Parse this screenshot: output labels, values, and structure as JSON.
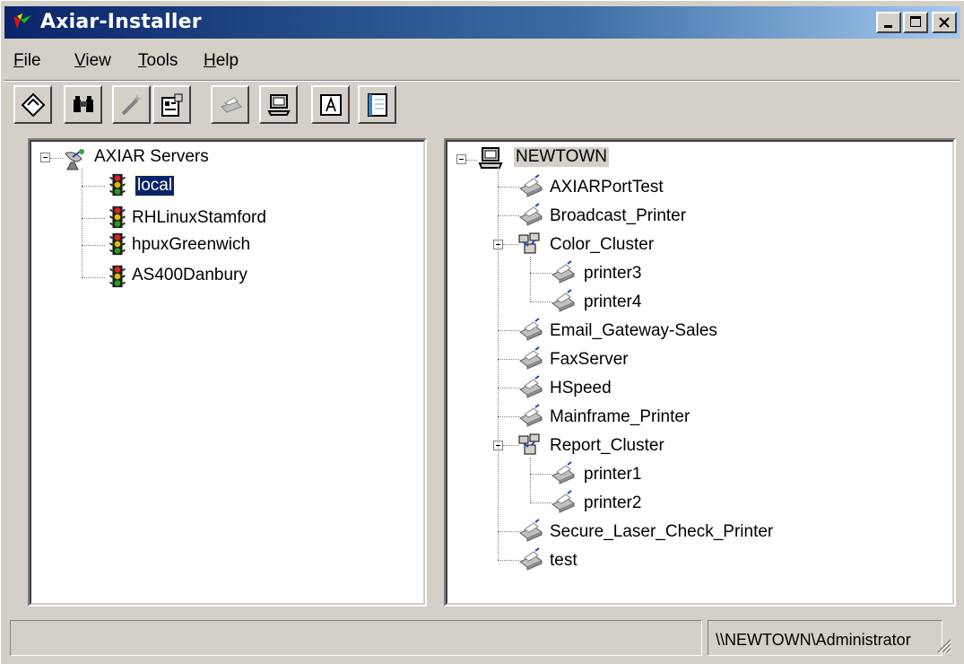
{
  "window": {
    "title": "Axiar-Installer"
  },
  "menu": {
    "file": {
      "key": "F",
      "rest": "ile"
    },
    "view": {
      "key": "V",
      "rest": "iew"
    },
    "tools": {
      "key": "T",
      "rest": "ools"
    },
    "help": {
      "key": "H",
      "rest": "elp"
    }
  },
  "toolbar": {
    "icons": [
      "diamond-icon",
      "binoculars-icon",
      "wand-icon",
      "properties-icon",
      "printer-icon",
      "computer-icon",
      "font-icon",
      "notepad-icon"
    ]
  },
  "left_tree": {
    "root": "AXIAR Servers",
    "items": [
      "local",
      "RHLinuxStamford",
      "hpuxGreenwich",
      "AS400Danbury"
    ],
    "selected": "local"
  },
  "right_tree": {
    "root": "NEWTOWN",
    "items": [
      {
        "label": "AXIARPortTest"
      },
      {
        "label": "Broadcast_Printer"
      },
      {
        "label": "Color_Cluster",
        "children": [
          "printer3",
          "printer4"
        ]
      },
      {
        "label": "Email_Gateway-Sales"
      },
      {
        "label": "FaxServer"
      },
      {
        "label": "HSpeed"
      },
      {
        "label": "Mainframe_Printer"
      },
      {
        "label": "Report_Cluster",
        "children": [
          "printer1",
          "printer2"
        ]
      },
      {
        "label": "Secure_Laser_Check_Printer"
      },
      {
        "label": "test"
      }
    ]
  },
  "status": {
    "left": "",
    "right": "\\\\NEWTOWN\\Administrator"
  },
  "colors": {
    "titlebar": "#0a246a",
    "selection": "#0a246a",
    "face": "#d4d0c8"
  }
}
